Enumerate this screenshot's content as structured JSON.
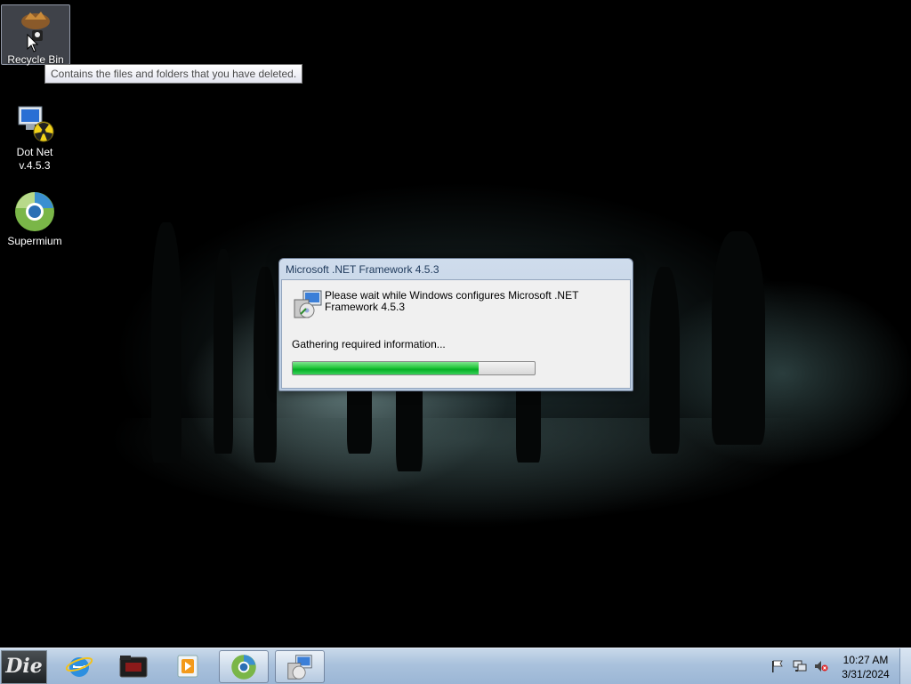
{
  "desktop": {
    "icons": [
      {
        "label": "Recycle Bin",
        "icon": "recycle-bin-icon"
      },
      {
        "label_line1": "Dot Net",
        "label_line2": "v.4.5.3",
        "icon": "dotnet-installer-icon"
      },
      {
        "label": "Supermium",
        "icon": "supermium-browser-icon"
      }
    ],
    "tooltip": "Contains the files and folders that you have deleted."
  },
  "dialog": {
    "title": "Microsoft .NET Framework 4.5.3",
    "message": "Please wait while Windows configures Microsoft .NET Framework 4.5.3",
    "status": "Gathering required information...",
    "progress": 0.77
  },
  "taskbar": {
    "start_label": "Die",
    "buttons": [
      {
        "name": "internet-explorer",
        "active": false
      },
      {
        "name": "file-explorer",
        "active": false
      },
      {
        "name": "media-player",
        "active": false
      },
      {
        "name": "supermium",
        "active": true
      },
      {
        "name": "dotnet-setup",
        "active": true
      }
    ],
    "clock": {
      "time": "10:27 AM",
      "date": "3/31/2024"
    }
  },
  "colors": {
    "progress_green": "#06b025",
    "taskbar": "#a9c1dc",
    "dialog_frame": "#b9cbe1"
  }
}
